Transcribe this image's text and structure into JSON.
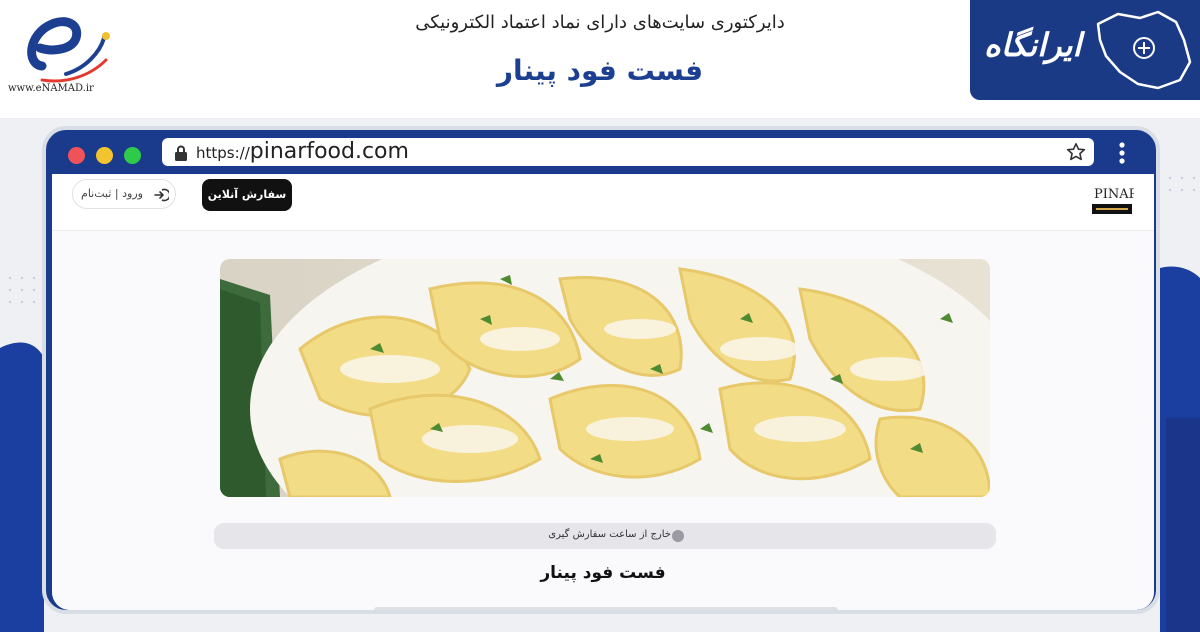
{
  "banner": {
    "enamad_url": "www.eNAMAD.ir",
    "directory_title": "دایرکتوری سایت‌های دارای نماد اعتماد الکترونیکی",
    "site_title": "فست فود پینار",
    "brand_name": "ایرانگاه",
    "brand_color": "#1b3a86",
    "title_color": "#1c3f91"
  },
  "browser": {
    "url_protocol": "https://",
    "url_domain": "pinarfood.com",
    "lock_icon": "lock-icon",
    "bookmark_icon": "star-icon",
    "menu_icon": "kebab-menu-icon",
    "frame_color": "#1a3a8c"
  },
  "site": {
    "login_label": "ورود | ثبت‌نام",
    "order_button": "سفارش آنلاین",
    "logo_text": "PINAR",
    "status_text": "خارج از ساعت سفارش گیری",
    "restaurant_name": "فست فود پینار"
  }
}
